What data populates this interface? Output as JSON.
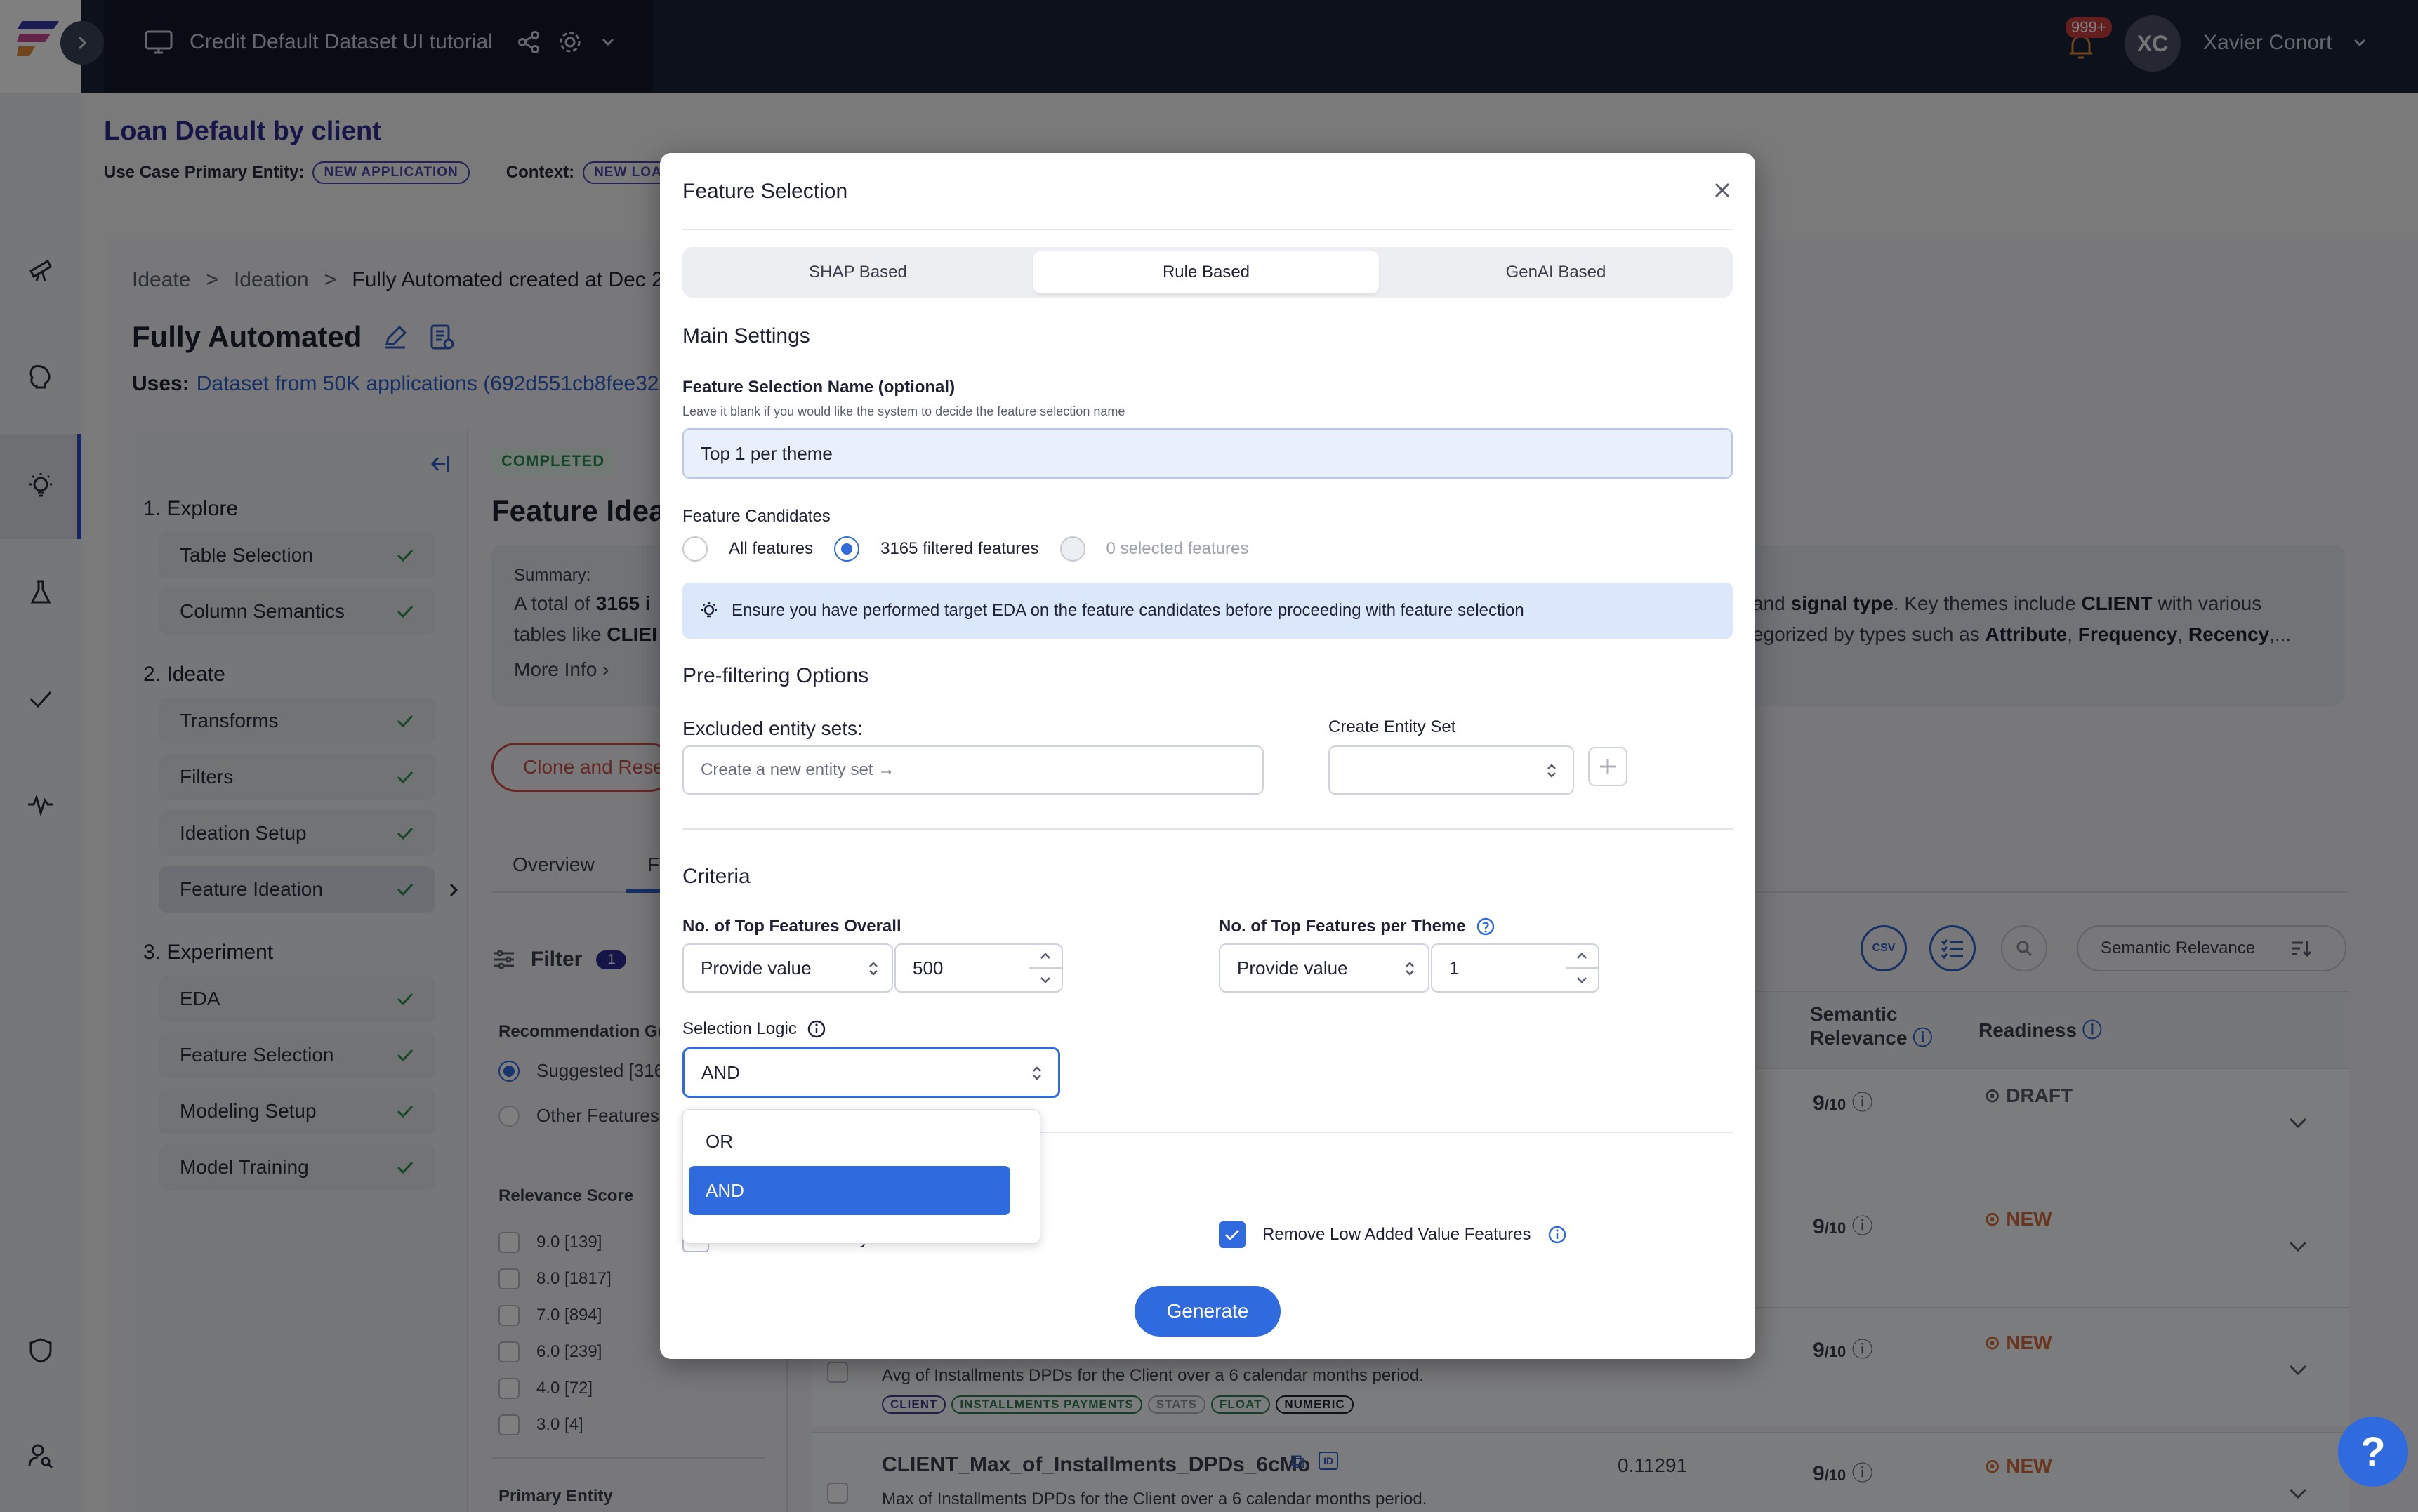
{
  "app": {
    "project_title": "Credit Default Dataset UI tutorial",
    "notification_count": "999+",
    "user_initials": "XC",
    "user_name": "Xavier Conort"
  },
  "header": {
    "use_case_title": "Loan Default by client",
    "primary_entity_label": "Use Case Primary Entity:",
    "primary_entity_tag": "NEW APPLICATION",
    "context_label": "Context:",
    "context_tag": "NEW LOA"
  },
  "breadcrumb": [
    "Ideate",
    "Ideation",
    "Fully Automated created at Dec 2,"
  ],
  "page": {
    "title": "Fully Automated",
    "uses_label": "Uses:",
    "uses_link": "Dataset from 50K applications (692d551cb8fee32"
  },
  "steps": {
    "explore": {
      "head": "1. Explore",
      "items": [
        "Table Selection",
        "Column Semantics"
      ]
    },
    "ideate": {
      "head": "2. Ideate",
      "items": [
        "Transforms",
        "Filters",
        "Ideation Setup",
        "Feature Ideation"
      ]
    },
    "experiment": {
      "head": "3. Experiment",
      "items": [
        "EDA",
        "Feature Selection",
        "Modeling Setup",
        "Model Training"
      ]
    }
  },
  "background": {
    "status_badge": "COMPLETED",
    "section_title": "Feature Idea",
    "summary_label": "Summary:",
    "summary_line1_start": "A total of",
    "summary_line1_bold": "3165 i",
    "summary_line2_start": "tables like",
    "summary_line2_bold": "CLIEI",
    "summary_right1_a": "and",
    "summary_right1_b": "signal type",
    "summary_right1_c": ". Key themes include",
    "summary_right1_d": "CLIENT",
    "summary_right1_e": "with various",
    "summary_right2_a": "egorized by types such as",
    "summary_right2_b": "Attribute",
    "summary_right2_c": "Frequency",
    "summary_right2_d": "Recency",
    "summary_right2_e": ",...",
    "more_info": "More Info",
    "clone_button": "Clone and Rese",
    "tab_overview": "Overview",
    "tab_f": "F",
    "filter_label": "Filter",
    "filter_count": "1",
    "recommendation_head": "Recommendation Gu",
    "suggested_label": "Suggested [316",
    "other_features_label": "Other Features",
    "relevance_head": "Relevance Score",
    "relevance_items": [
      "9.0 [139]",
      "8.0 [1817]",
      "7.0 [894]",
      "6.0 [239]",
      "4.0 [72]",
      "3.0 [4]"
    ],
    "primary_entity_head": "Primary Entity",
    "sort_label": "Semantic Relevance",
    "col_semantic": "Semantic",
    "col_relevance": "Relevance",
    "col_readiness": "Readiness",
    "rows": [
      {
        "score": "9",
        "of": "/10",
        "status": "DRAFT"
      },
      {
        "score": "9",
        "of": "/10",
        "status": "NEW"
      },
      {
        "score": "9",
        "of": "/10",
        "status": "NEW",
        "desc": "Avg of Installments DPDs for the Client over a 6 calendar months period.",
        "pills": [
          "CLIENT",
          "INSTALLMENTS PAYMENTS",
          "STATS",
          "FLOAT",
          "NUMERIC"
        ]
      },
      {
        "score": "9",
        "of": "/10",
        "status": "NEW",
        "name": "CLIENT_Max_of_Installments_DPDs_6cMo",
        "value": "0.11291",
        "desc": "Max of Installments DPDs for the Client over a 6 calendar months period."
      }
    ]
  },
  "modal": {
    "title": "Feature Selection",
    "tabs": [
      "SHAP Based",
      "Rule Based",
      "GenAI Based"
    ],
    "active_tab": "Rule Based",
    "main_settings": "Main Settings",
    "name_label": "Feature Selection Name (optional)",
    "name_hint": "Leave it blank if you would like the system to decide the feature selection name",
    "name_value": "Top 1 per theme",
    "candidates_label": "Feature Candidates",
    "candidates": [
      "All features",
      "3165 filtered features",
      "0 selected features"
    ],
    "candidates_selected": "3165 filtered features",
    "eda_notice": "Ensure you have performed target EDA on the feature candidates before proceeding with feature selection",
    "prefilter_title": "Pre-filtering Options",
    "excluded_label": "Excluded entity sets:",
    "excluded_placeholder": "Create a new entity set →",
    "create_entity_label": "Create Entity Set",
    "criteria_title": "Criteria",
    "top_overall_label": "No. of Top Features Overall",
    "top_overall_mode": "Provide value",
    "top_overall_value": "500",
    "top_theme_label": "No. of Top Features per Theme",
    "top_theme_mode": "Provide value",
    "top_theme_value": "1",
    "logic_label": "Selection Logic",
    "logic_value": "AND",
    "logic_options": [
      "OR",
      "AND"
    ],
    "remove_dict_label": "Remove Dictionary and Vector Features",
    "remove_dict_checked": false,
    "remove_low_label": "Remove Low Added Value Features",
    "remove_low_checked": true,
    "generate_label": "Generate"
  },
  "help_fab": "?",
  "colors": {
    "accent": "#2f6bde",
    "brand": "#2d2a8e",
    "topbar": "#1b2236",
    "success": "#2e8a52",
    "danger": "#c7514b",
    "new_status": "#d46a3a"
  }
}
